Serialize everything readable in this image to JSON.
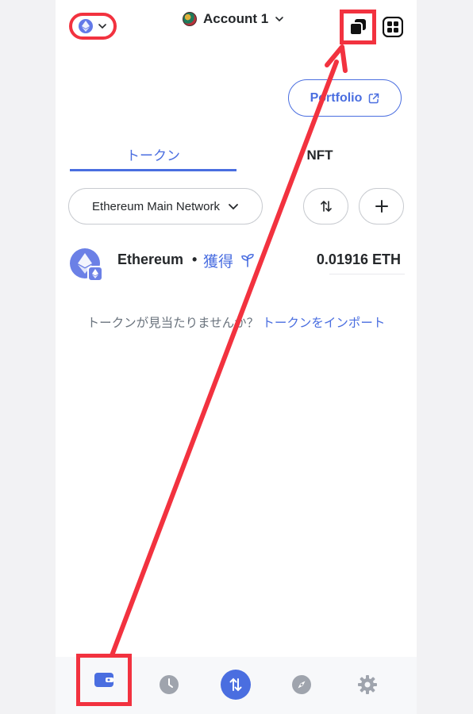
{
  "header": {
    "network_icon": "ethereum-icon",
    "account_name": "Account 1",
    "copy_icon": "copy-icon",
    "scan_icon": "qr-scan-icon"
  },
  "portfolio": {
    "label": "Portfolio",
    "icon": "external-link-icon"
  },
  "tabs": [
    {
      "label": "トークン",
      "active": true
    },
    {
      "label": "NFT",
      "active": false
    }
  ],
  "filter": {
    "network_label": "Ethereum Main Network",
    "sort_icon": "sort-arrows-icon",
    "add_icon": "plus-icon"
  },
  "tokens": [
    {
      "name": "Ethereum",
      "separator": "•",
      "earn_label": "獲得",
      "earn_icon": "sprout-icon",
      "balance": "0.01916 ETH"
    }
  ],
  "import_prompt": {
    "text": "トークンが見当たりませんか？",
    "link": "トークンをインポート"
  },
  "bottom_nav": [
    {
      "name": "wallet",
      "icon": "wallet-icon",
      "active": true
    },
    {
      "name": "activity",
      "icon": "clock-icon",
      "active": false
    },
    {
      "name": "swap",
      "icon": "swap-arrows-icon",
      "active": false
    },
    {
      "name": "browser",
      "icon": "compass-icon",
      "active": false
    },
    {
      "name": "settings",
      "icon": "gear-icon",
      "active": false
    }
  ],
  "colors": {
    "accent": "#4a6ee0",
    "annotation": "#f2323f",
    "text_primary": "#24272a",
    "text_muted": "#6a737d"
  }
}
